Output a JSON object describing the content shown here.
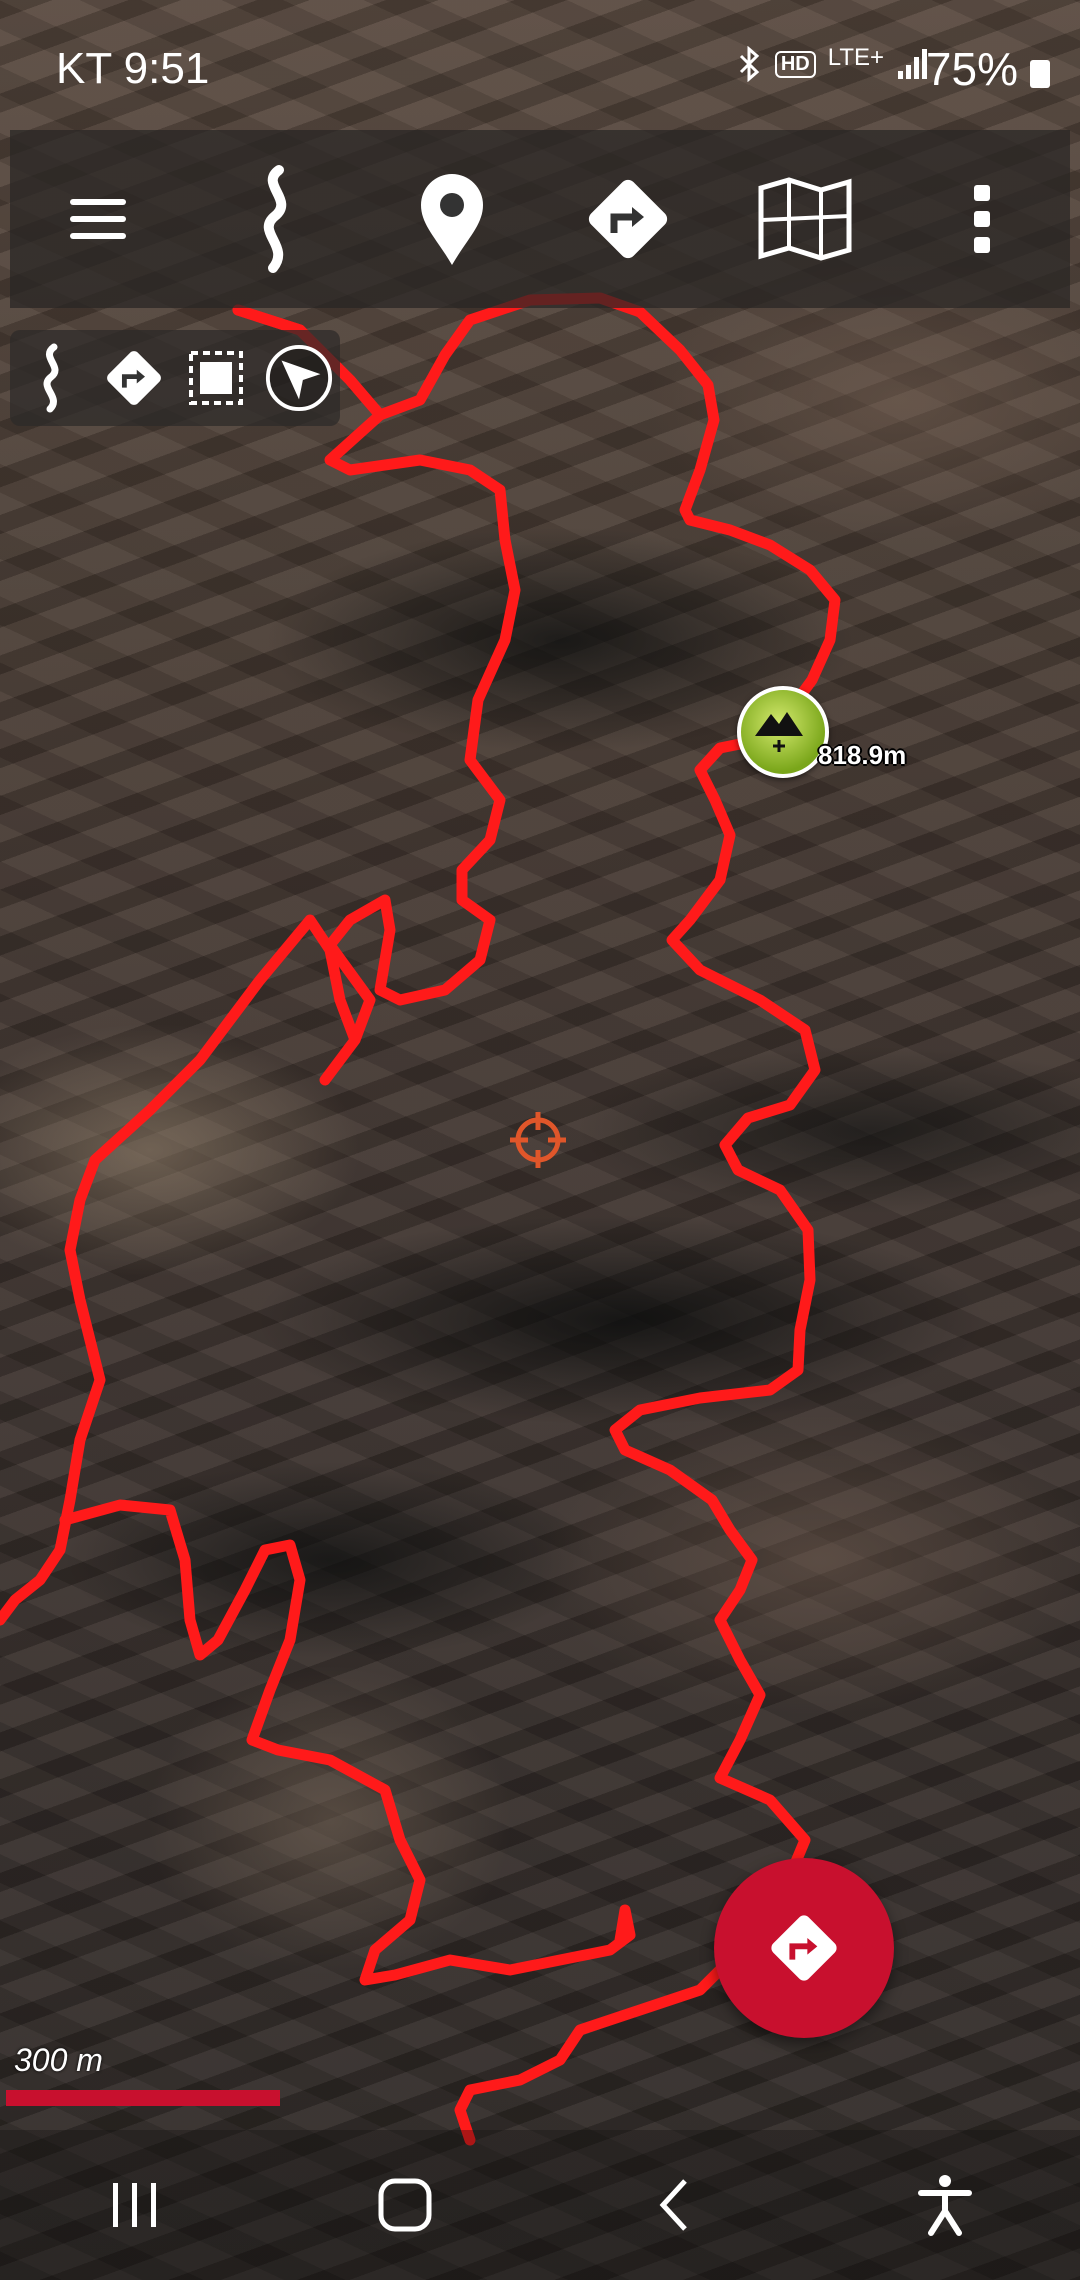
{
  "status_bar": {
    "time": "KT 9:51",
    "network": "LTE+",
    "hd_badge": "HD",
    "battery": "75%",
    "icons": [
      "bluetooth-icon",
      "hd-voice-icon",
      "lte-plus-icon",
      "signal-icon",
      "battery-icon"
    ]
  },
  "toolbar": {
    "items": [
      {
        "icon": "menu-icon"
      },
      {
        "icon": "track-icon"
      },
      {
        "icon": "waypoint-pin-icon"
      },
      {
        "icon": "route-icon"
      },
      {
        "icon": "map-layers-icon"
      },
      {
        "icon": "more-vertical-icon"
      }
    ]
  },
  "mini_tools": {
    "items": [
      {
        "icon": "track-icon"
      },
      {
        "icon": "route-icon"
      },
      {
        "icon": "select-area-icon"
      },
      {
        "icon": "locate-arrow-icon"
      }
    ]
  },
  "map": {
    "peak_label": "818.9m",
    "scale_label": "300 m",
    "trail_color": "#ff1a1a",
    "accent_color": "#c8102e"
  },
  "fab": {
    "icon": "route-directions-icon"
  },
  "navbar": {
    "items": [
      {
        "icon": "recent-apps-icon"
      },
      {
        "icon": "home-icon"
      },
      {
        "icon": "back-icon"
      },
      {
        "icon": "accessibility-icon"
      }
    ]
  }
}
